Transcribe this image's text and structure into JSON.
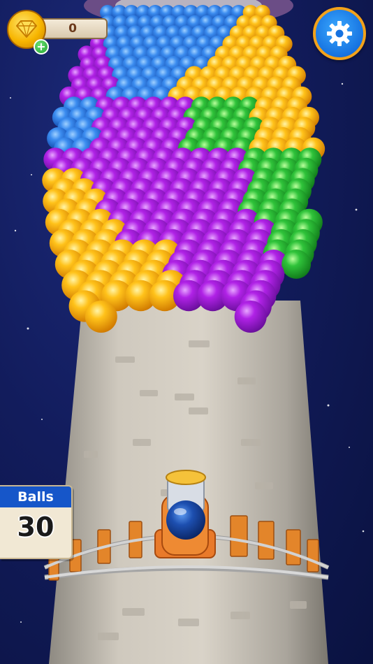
{
  "hud": {
    "gems": {
      "count": "0",
      "add_label": "+"
    },
    "balls": {
      "label": "Balls",
      "count": "30"
    }
  },
  "icons": {
    "gem": "diamond-icon",
    "add": "plus-icon",
    "settings": "gear-icon"
  },
  "colors": {
    "background": "#121c5c",
    "ball_blue": "#1e6fe0",
    "ball_yellow": "#f7b500",
    "ball_purple": "#a41fd6",
    "ball_green": "#2bbf2b",
    "panel_header": "#1656c9",
    "gear_button": "#1672e0",
    "gear_ring": "#f3a21a",
    "tower": "#c9c4ba",
    "rail_ties": "#e3852a"
  }
}
